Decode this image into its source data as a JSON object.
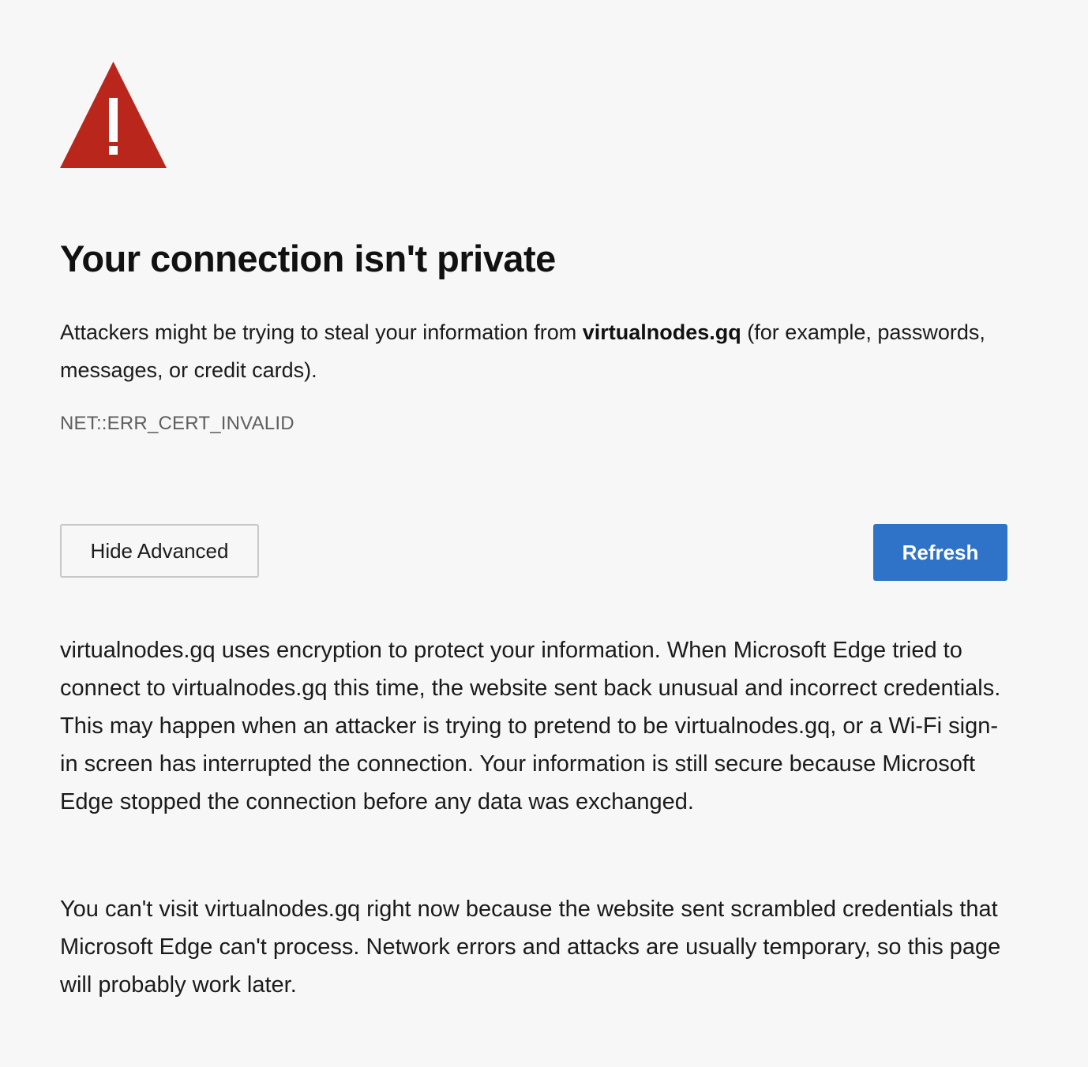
{
  "page": {
    "title": "Your connection isn't private",
    "intro_before": "Attackers might be trying to steal your information from ",
    "intro_domain": "virtualnodes.gq",
    "intro_after": " (for example, passwords, messages, or credit cards).",
    "error_code": "NET::ERR_CERT_INVALID"
  },
  "buttons": {
    "hide_advanced": "Hide Advanced",
    "refresh": "Refresh"
  },
  "details": {
    "paragraph1": "virtualnodes.gq uses encryption to protect your information. When Microsoft Edge tried to connect to virtualnodes.gq this time, the website sent back unusual and incorrect credentials. This may happen when an attacker is trying to pretend to be virtualnodes.gq, or a Wi-Fi sign-in screen has interrupted the connection. Your information is still secure because Microsoft Edge stopped the connection before any data was exchanged.",
    "paragraph2": "You can't visit virtualnodes.gq right now because the website sent scrambled credentials that Microsoft Edge can't process. Network errors and attacks are usually temporary, so this page will probably work later."
  },
  "colors": {
    "warning_red": "#b9261c",
    "primary_blue": "#2e73c8",
    "background": "#f7f7f7"
  },
  "icons": {
    "warning": "warning-triangle-icon"
  }
}
